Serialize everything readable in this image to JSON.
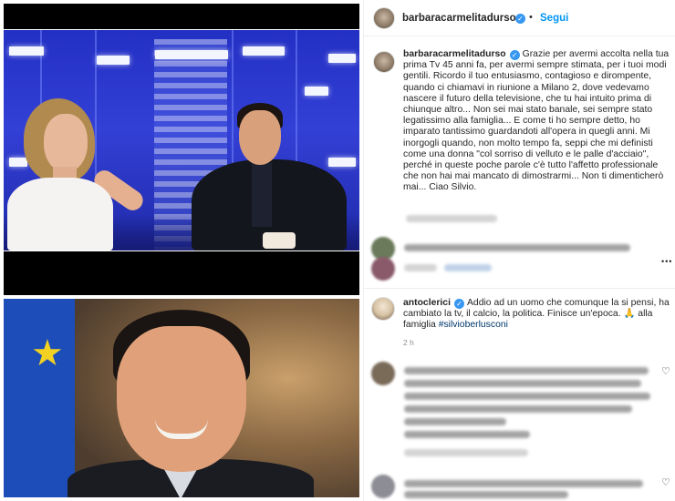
{
  "post1": {
    "account": "barbaracarmelitadurso",
    "follow_label": "Segui",
    "separator": "•",
    "caption_text": "Grazie per avermi accolta nella tua prima Tv 45 anni fa, per avermi sempre stimata, per i tuoi modi gentili. Ricordo il tuo entusiasmo, contagioso e dirompente, quando ci chiamavi in riunione a Milano 2, dove vedevamo nascere il futuro della televisione, che tu hai intuito prima di chiunque altro... Non sei mai stato banale, sei sempre stato legatissimo alla famiglia... E come ti ho sempre detto, ho imparato tantissimo guardandoti all'opera in quegli anni. Mi inorgogli quando, non molto tempo fa, seppi che mi definisti come una donna \"col sorriso di velluto e le palle d'acciaio\", perché in queste poche parole c'è tutto l'affetto professionale che non hai mai mancato di dimostrarmi... Non ti dimenticherò mai... Ciao Silvio.",
    "verified_mark": "✓",
    "more_icon": "more-horizontal-icon",
    "more_glyph": "•••",
    "blurred_reply_label": "Rispondi"
  },
  "post2": {
    "account": "antoclerici",
    "caption_text": "Addio ad un uomo che comunque la si pensi, ha cambiato la tv, il calcio, la politica. Finisce un'epoca. 🙏 alla famiglia",
    "hashtag": "#silvioberlusconi",
    "time": "2 h",
    "verified_mark": "✓",
    "heart_glyph": "♡"
  },
  "colors": {
    "link_blue": "#0095f6",
    "verified_blue": "#3897f0",
    "hashtag": "#00376b",
    "muted": "#8e8e8e"
  }
}
